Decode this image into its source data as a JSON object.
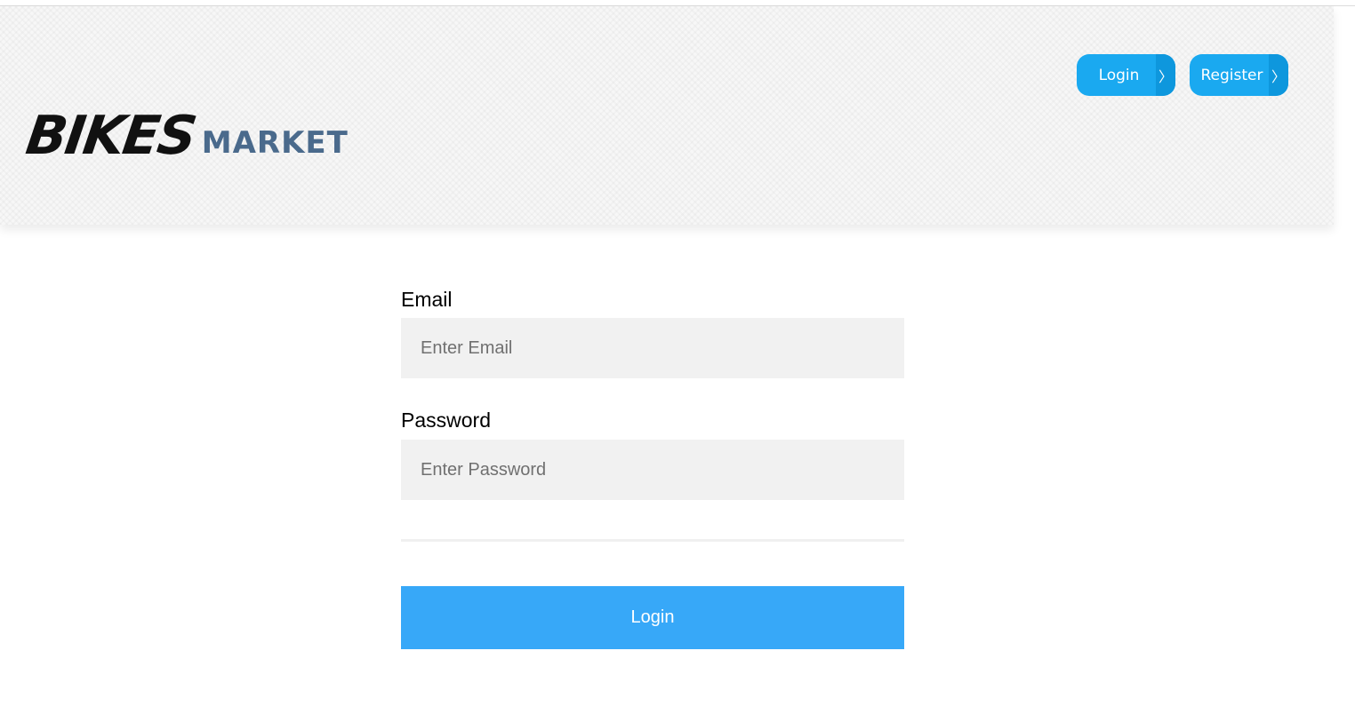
{
  "header": {
    "logo": {
      "primary": "BIKES",
      "secondary": "MARKET"
    },
    "nav": {
      "login_label": "Login",
      "register_label": "Register",
      "chevron": "〉"
    }
  },
  "form": {
    "email": {
      "label": "Email",
      "placeholder": "Enter Email"
    },
    "password": {
      "label": "Password",
      "placeholder": "Enter Password"
    },
    "submit_label": "Login"
  },
  "colors": {
    "nav_button": "#1aa9f0",
    "submit_button": "#37a8f8",
    "logo_secondary": "#4a6a8c"
  }
}
